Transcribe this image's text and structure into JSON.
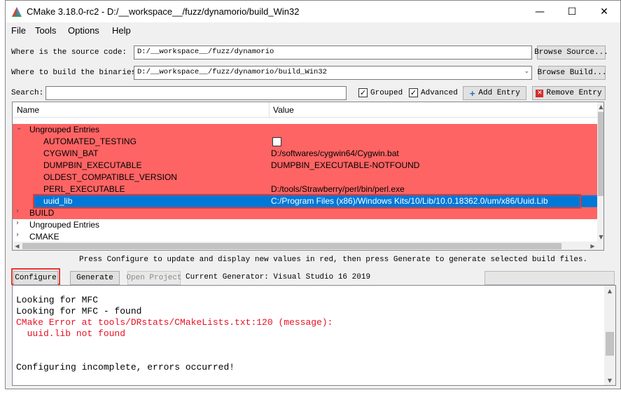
{
  "window": {
    "title": "CMake 3.18.0-rc2 - D:/__workspace__/fuzz/dynamorio/build_Win32",
    "minimize": "—",
    "maximize": "☐",
    "close": "✕"
  },
  "menu": [
    "File",
    "Tools",
    "Options",
    "Help"
  ],
  "source": {
    "label": "Where is the source code:",
    "value": "D:/__workspace__/fuzz/dynamorio",
    "browse": "Browse Source..."
  },
  "build": {
    "label": "Where to build the binaries:",
    "value": "D:/__workspace__/fuzz/dynamorio/build_Win32",
    "browse": "Browse Build..."
  },
  "search": {
    "label": "Search:",
    "value": "",
    "grouped_label": "Grouped",
    "grouped_checked": true,
    "advanced_label": "Advanced",
    "advanced_checked": true,
    "add_entry": "Add Entry",
    "remove_entry": "Remove Entry"
  },
  "table": {
    "col_name": "Name",
    "col_value": "Value",
    "rows": [
      {
        "name": "Ungrouped Entries",
        "value": "",
        "kind": "group-open"
      },
      {
        "name": "AUTOMATED_TESTING",
        "value": "",
        "kind": "checkbox"
      },
      {
        "name": "CYGWIN_BAT",
        "value": "D:/softwares/cygwin64/Cygwin.bat",
        "kind": "entry"
      },
      {
        "name": "DUMPBIN_EXECUTABLE",
        "value": "DUMPBIN_EXECUTABLE-NOTFOUND",
        "kind": "entry"
      },
      {
        "name": "OLDEST_COMPATIBLE_VERSION",
        "value": "",
        "kind": "entry"
      },
      {
        "name": "PERL_EXECUTABLE",
        "value": "D:/tools/Strawberry/perl/bin/perl.exe",
        "kind": "entry"
      },
      {
        "name": "uuid_lib",
        "value": "C:/Program Files (x86)/Windows Kits/10/Lib/10.0.18362.0/um/x86/Uuid.Lib",
        "kind": "selected"
      },
      {
        "name": "BUILD",
        "value": "",
        "kind": "group-closed-red"
      },
      {
        "name": "Ungrouped Entries",
        "value": "",
        "kind": "group-closed"
      },
      {
        "name": "CMAKE",
        "value": "",
        "kind": "group-closed"
      }
    ]
  },
  "hint": "Press Configure to update and display new values in red, then press Generate to generate selected build files.",
  "actions": {
    "configure": "Configure",
    "generate": "Generate",
    "open_project": "Open Project",
    "generator_label": "Current Generator: Visual Studio 16 2019"
  },
  "output": [
    {
      "text": "Looking for MFC",
      "error": false
    },
    {
      "text": "Looking for MFC - found",
      "error": false
    },
    {
      "text": "CMake Error at tools/DRstats/CMakeLists.txt:120 (message):",
      "error": true
    },
    {
      "text": "  uuid.lib not found",
      "error": true
    },
    {
      "text": "",
      "error": false
    },
    {
      "text": "",
      "error": false
    },
    {
      "text": "Configuring incomplete, errors occurred!",
      "error": false
    }
  ],
  "colors": {
    "changed_row": "#ff6464",
    "selection": "#0078d7",
    "error_text": "#e81123",
    "highlight_box": "#e53935"
  }
}
